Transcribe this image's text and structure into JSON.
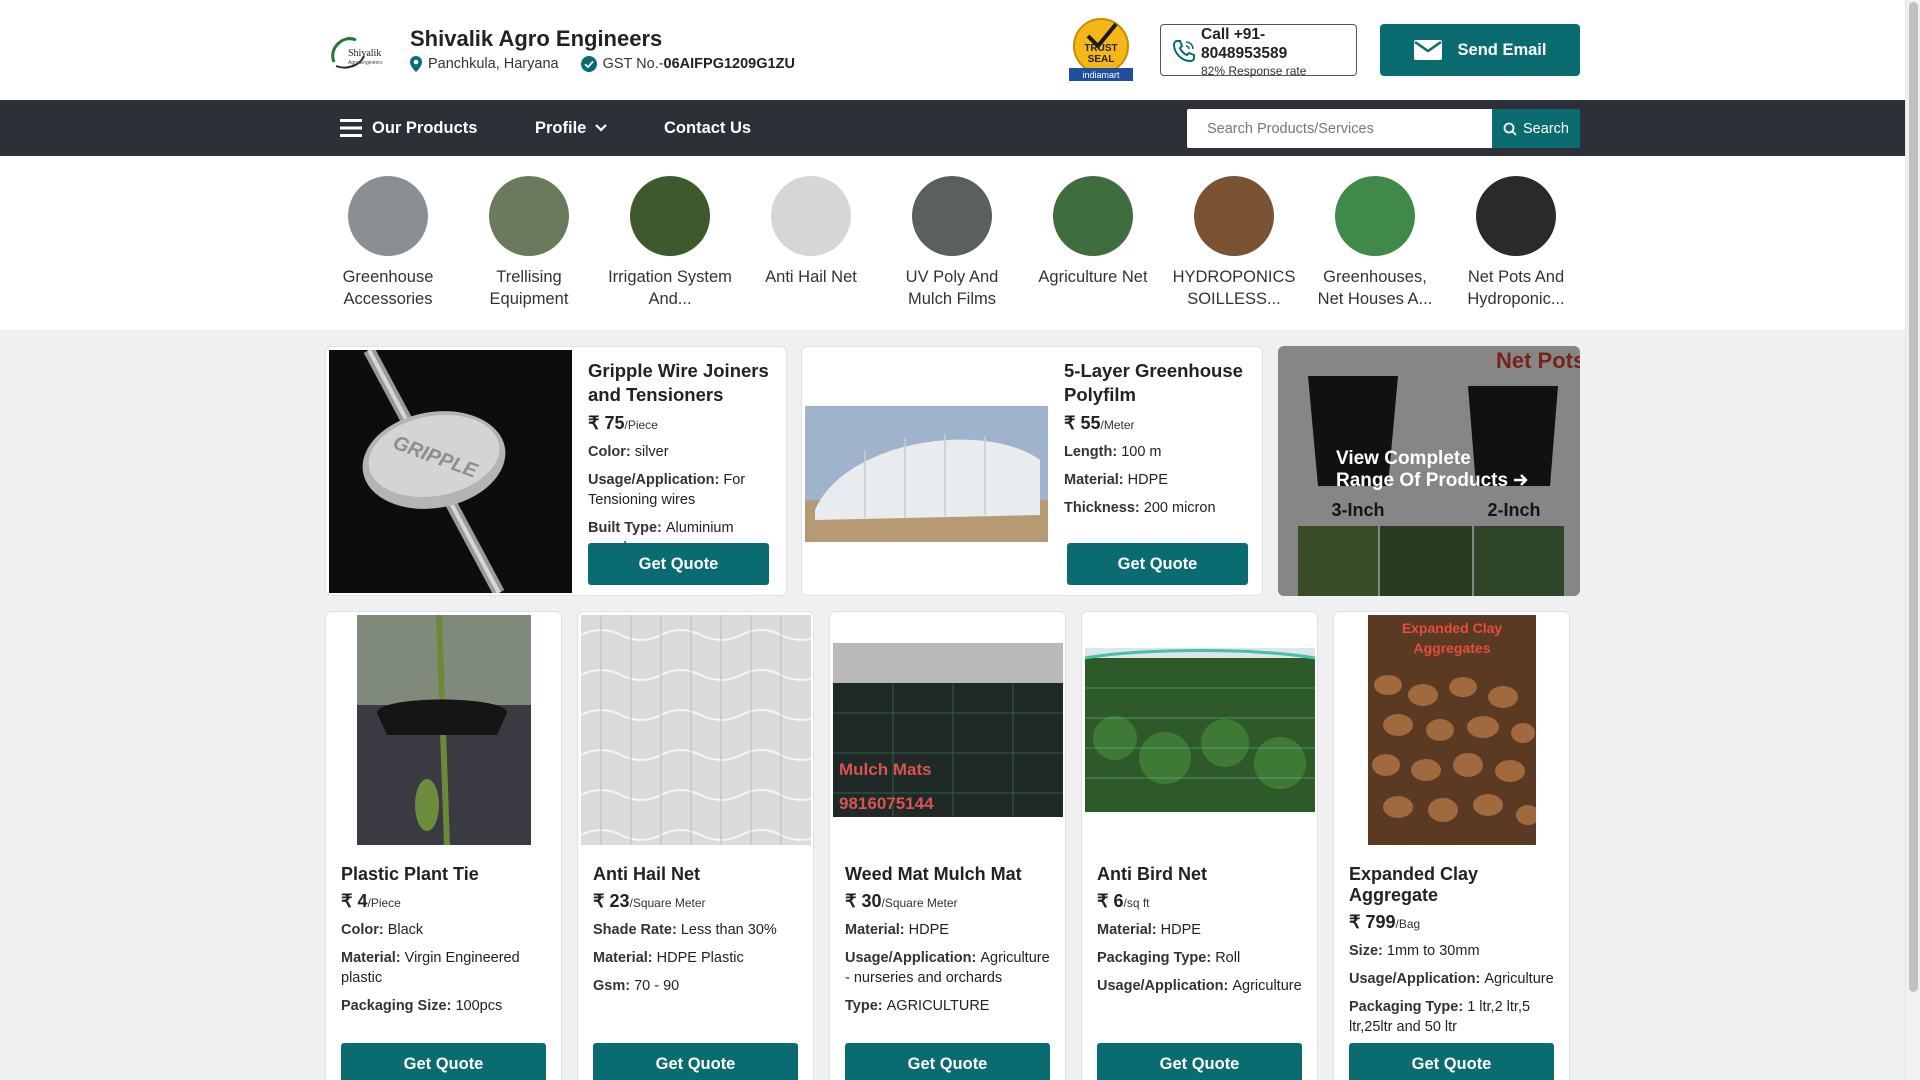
{
  "header": {
    "company": "Shivalik Agro Engineers",
    "location": "Panchkula, Haryana",
    "gst_label": "GST No.-",
    "gst_value": "06AIFPG1209G1ZU",
    "logo_text": "Shivalik",
    "logo_sub": "Agro Engineers",
    "trust_seal": [
      "TRUST",
      "SEAL",
      "indiamart"
    ],
    "call_label": "Call +91-8048953589",
    "response_rate": "82% Response rate",
    "email_button": "Send Email"
  },
  "nav": {
    "products": "Our Products",
    "profile": "Profile",
    "contact": "Contact Us",
    "search_placeholder": "Search Products/Services",
    "search_button": "Search"
  },
  "categories": [
    {
      "label": "Greenhouse Accessories",
      "color": "#8a8f93"
    },
    {
      "label": "Trellising Equipment",
      "color": "#6b7a5a"
    },
    {
      "label": "Irrigation System And...",
      "color": "#3c5a2c"
    },
    {
      "label": "Anti Hail Net",
      "color": "#d4d6d8"
    },
    {
      "label": "UV Poly And Mulch Films",
      "color": "#5a6060"
    },
    {
      "label": "Agriculture Net",
      "color": "#3f6e3e"
    },
    {
      "label": "HYDROPONICS SOILLESS...",
      "color": "#7a5334"
    },
    {
      "label": "Greenhouses, Net Houses A...",
      "color": "#3f8a4a"
    },
    {
      "label": "Net Pots And Hydroponic...",
      "color": "#2a2a2a"
    }
  ],
  "featured": [
    {
      "title": "Gripple Wire Joiners and Tensioners",
      "price": "75",
      "unit": "/Piece",
      "specs": [
        {
          "k": "Color: ",
          "v": "silver"
        },
        {
          "k": "Usage/Application: ",
          "v": "For Tensioning wires"
        },
        {
          "k": "Built Type: ",
          "v": "Aluminium cased"
        }
      ],
      "quote": "Get Quote",
      "image_text": "GRIPPLE"
    },
    {
      "title": "5-Layer Greenhouse Polyfilm",
      "price": "55",
      "unit": "/Meter",
      "specs": [
        {
          "k": "Length: ",
          "v": "100 m"
        },
        {
          "k": "Material: ",
          "v": "HDPE"
        },
        {
          "k": "Thickness: ",
          "v": "200 micron"
        }
      ],
      "quote": "Get Quote"
    }
  ],
  "view_all": {
    "line1": "View Complete",
    "line2": "Range Of Products",
    "image_title": "Net Pots",
    "image_labels": [
      "3-Inch",
      "2-Inch"
    ]
  },
  "products": [
    {
      "title": "Plastic Plant Tie",
      "price": "4",
      "unit": "/Piece",
      "specs": [
        {
          "k": "Color: ",
          "v": "Black"
        },
        {
          "k": "Material: ",
          "v": "Virgin Engineered plastic"
        },
        {
          "k": "Packaging Size: ",
          "v": "100pcs"
        }
      ],
      "quote": "Get Quote"
    },
    {
      "title": "Anti Hail Net",
      "price": "23",
      "unit": "/Square Meter",
      "specs": [
        {
          "k": "Shade Rate: ",
          "v": "Less than 30%"
        },
        {
          "k": "Material: ",
          "v": "HDPE Plastic"
        },
        {
          "k": "Gsm: ",
          "v": "70 - 90"
        }
      ],
      "quote": "Get Quote"
    },
    {
      "title": "Weed Mat Mulch Mat",
      "price": "30",
      "unit": "/Square Meter",
      "specs": [
        {
          "k": "Material: ",
          "v": "HDPE"
        },
        {
          "k": "Usage/Application: ",
          "v": "Agriculture - nurseries and orchards"
        },
        {
          "k": "Type: ",
          "v": "AGRICULTURE"
        }
      ],
      "quote": "Get Quote",
      "image_text": [
        "Mulch Mats",
        "9816075144"
      ]
    },
    {
      "title": "Anti Bird Net",
      "price": "6",
      "unit": "/sq ft",
      "specs": [
        {
          "k": "Material: ",
          "v": "HDPE"
        },
        {
          "k": "Packaging Type: ",
          "v": "Roll"
        },
        {
          "k": "Usage/Application: ",
          "v": "Agriculture"
        }
      ],
      "quote": "Get Quote"
    },
    {
      "title": "Expanded Clay Aggregate",
      "price": "799",
      "unit": "/Bag",
      "specs": [
        {
          "k": "Size: ",
          "v": "1mm to 30mm"
        },
        {
          "k": "Usage/Application: ",
          "v": "Agriculture"
        },
        {
          "k": "Packaging Type: ",
          "v": "1 ltr,2 ltr,5 ltr,25ltr and 50 ltr"
        }
      ],
      "quote": "Get Quote",
      "image_text": [
        "Expanded Clay",
        "Aggregates"
      ]
    }
  ],
  "currency_symbol": "₹",
  "colors": {
    "accent": "#0a6c70",
    "nav_bg": "#2e3038",
    "page_bg": "#eef0f2"
  }
}
